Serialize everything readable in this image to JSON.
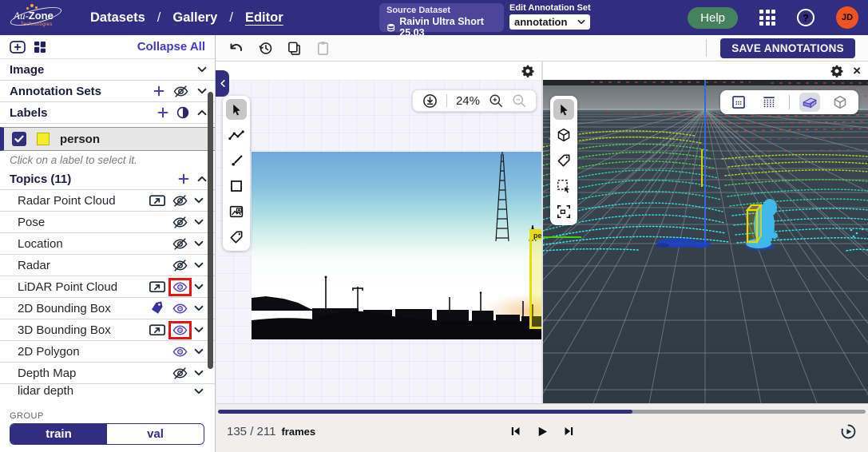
{
  "navbar": {
    "brand": {
      "name_a": "Au-",
      "name_b": "Zone",
      "tagline": "Technologies"
    },
    "nav": [
      "Datasets",
      "Gallery",
      "Editor"
    ],
    "separator": "/",
    "source_dataset": {
      "label": "Source Dataset",
      "value": "Raivin Ultra Short 25.03"
    },
    "edit_annotation_set": {
      "label": "Edit Annotation Set",
      "value": "annotation"
    },
    "help": "Help",
    "avatar_initials": "JD"
  },
  "toolbar": {
    "save": "SAVE ANNOTATIONS"
  },
  "sidebar": {
    "collapse_all": "Collapse All",
    "sections": {
      "image": "Image",
      "annotation_sets": "Annotation Sets",
      "labels": "Labels"
    },
    "selected_label": {
      "name": "person",
      "color": "#f2ee2a",
      "checked": true
    },
    "hint": "Click on a label to select it.",
    "topics_title": "Topics (11)",
    "topics": [
      {
        "label": "Radar Point Cloud"
      },
      {
        "label": "Pose"
      },
      {
        "label": "Location"
      },
      {
        "label": "Radar"
      },
      {
        "label": "LiDAR Point Cloud"
      },
      {
        "label": "2D Bounding Box"
      },
      {
        "label": "3D Bounding Box"
      },
      {
        "label": "2D Polygon"
      },
      {
        "label": "Depth Map"
      },
      {
        "label": "lidar depth"
      }
    ],
    "group": {
      "label": "GROUP",
      "options": [
        "train",
        "val"
      ],
      "active": "train"
    }
  },
  "camera_view": {
    "zoom": "24%",
    "bbox_label": "pe"
  },
  "playback": {
    "current": "135 / 211",
    "unit": "frames",
    "progress_percent": 64
  },
  "colors": {
    "accent": "#312e81",
    "purple": "#4338ca",
    "highlight_red": "#ee1111",
    "label_yellow": "#f2ee2a",
    "help_green": "#47825f",
    "avatar_orange": "#f1531f"
  }
}
